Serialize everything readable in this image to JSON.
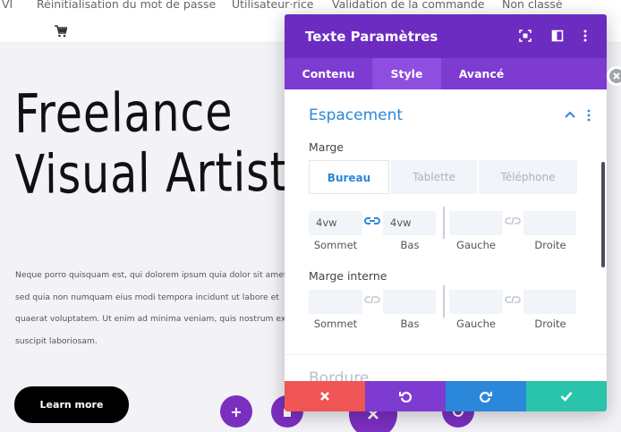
{
  "nav": {
    "items": [
      "VI",
      "Réinitialisation du mot de passe",
      "Utilisateur·rice",
      "Validation de la commande",
      "Non classé"
    ],
    "cart_icon": "shopping-cart-icon"
  },
  "hero": {
    "title_line1": "Freelance",
    "title_line2": "Visual Artist",
    "paragraph": "Neque porro quisquam est, qui dolorem ipsum quia dolor sit amet\nsed quia non numquam eius modi tempora incidunt ut labore et\nquaerat voluptatem. Ut enim ad minima veniam, quis nostrum ex\nsuscipit laboriosam.",
    "button_label": "Learn more"
  },
  "builder_buttons": {
    "add": "+"
  },
  "panel": {
    "title": "Texte Paramètres",
    "tabs": [
      "Contenu",
      "Style",
      "Avancé"
    ],
    "active_tab": "Style",
    "section_title": "Espacement",
    "margin_label": "Marge",
    "devices": [
      "Bureau",
      "Tablette",
      "Téléphone"
    ],
    "active_device": "Bureau",
    "margin": {
      "top": "4vw",
      "bottom": "4vw",
      "left": "",
      "right": ""
    },
    "padding_label": "Marge interne",
    "padding": {
      "top": "",
      "bottom": "",
      "left": "",
      "right": ""
    },
    "side_labels": [
      "Sommet",
      "Bas",
      "Gauche",
      "Droite"
    ],
    "next_section": "Bordure"
  },
  "colors": {
    "panel_header": "#6c2bc1",
    "tabs_bg": "#7d3bd1",
    "accent_blue": "#2b87da",
    "cancel": "#ef5555",
    "undo": "#7d3bd1",
    "redo": "#2b87da",
    "save": "#29c4a9"
  }
}
